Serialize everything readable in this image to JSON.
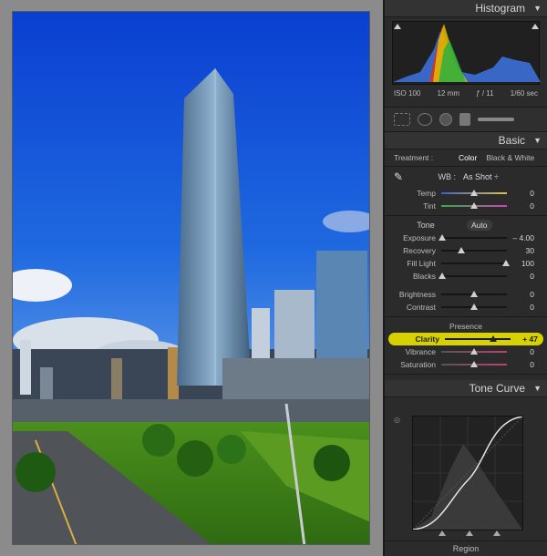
{
  "panel": {
    "histogram": {
      "title": "Histogram",
      "iso": "ISO 100",
      "focal": "12 mm",
      "aperture": "ƒ / 11",
      "shutter": "1/60 sec"
    },
    "basic": {
      "title": "Basic",
      "treatment_label": "Treatment :",
      "treatment_color": "Color",
      "treatment_bw": "Black & White",
      "wb_label": "WB :",
      "wb_value": "As Shot ÷",
      "tone_label": "Tone",
      "auto_label": "Auto",
      "presence_label": "Presence",
      "sliders": [
        {
          "label": "Temp",
          "value": "0",
          "pos": 0.5
        },
        {
          "label": "Tint",
          "value": "0",
          "pos": 0.5
        },
        {
          "label": "Exposure",
          "value": "– 4.00",
          "pos": 0.02
        },
        {
          "label": "Recovery",
          "value": "30",
          "pos": 0.3
        },
        {
          "label": "Fill Light",
          "value": "100",
          "pos": 0.98
        },
        {
          "label": "Blacks",
          "value": "0",
          "pos": 0.02
        },
        {
          "label": "Brightness",
          "value": "0",
          "pos": 0.5
        },
        {
          "label": "Contrast",
          "value": "0",
          "pos": 0.5
        },
        {
          "label": "Clarity",
          "value": "+ 47",
          "pos": 0.73
        },
        {
          "label": "Vibrance",
          "value": "0",
          "pos": 0.5
        },
        {
          "label": "Saturation",
          "value": "0",
          "pos": 0.5
        }
      ]
    },
    "tone_curve": {
      "title": "Tone Curve",
      "region_label": "Region"
    }
  }
}
